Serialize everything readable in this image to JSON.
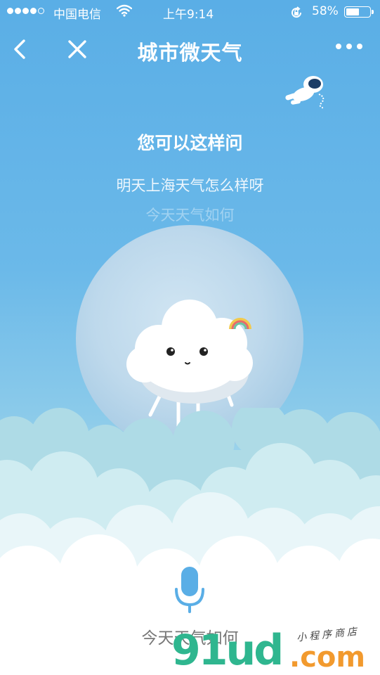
{
  "status_bar": {
    "carrier": "中国电信",
    "time": "上午9:14",
    "battery_percent": "58%",
    "battery_level": 0.58,
    "signal_bars_filled": 4,
    "signal_bars_total": 5,
    "icons": [
      "wifi-icon",
      "rotation-lock-icon",
      "battery-icon"
    ]
  },
  "nav": {
    "title": "城市微天气",
    "icons": [
      "back-icon",
      "close-icon",
      "more-icon"
    ]
  },
  "prompt": {
    "heading": "您可以这样问",
    "suggestions": [
      "明天上海天气怎么样呀",
      "今天天气如何"
    ]
  },
  "voice": {
    "recognized_text": "今天天气如何",
    "icon": "microphone-icon"
  },
  "watermark": {
    "logo_text": "91ud",
    "domain": ".com",
    "tagline": "小程序商店"
  },
  "colors": {
    "sky_top": "#5aaee6",
    "mic_blue": "#5aaee6",
    "watermark_green": "#2fb68f",
    "watermark_orange": "#f29a2e"
  }
}
